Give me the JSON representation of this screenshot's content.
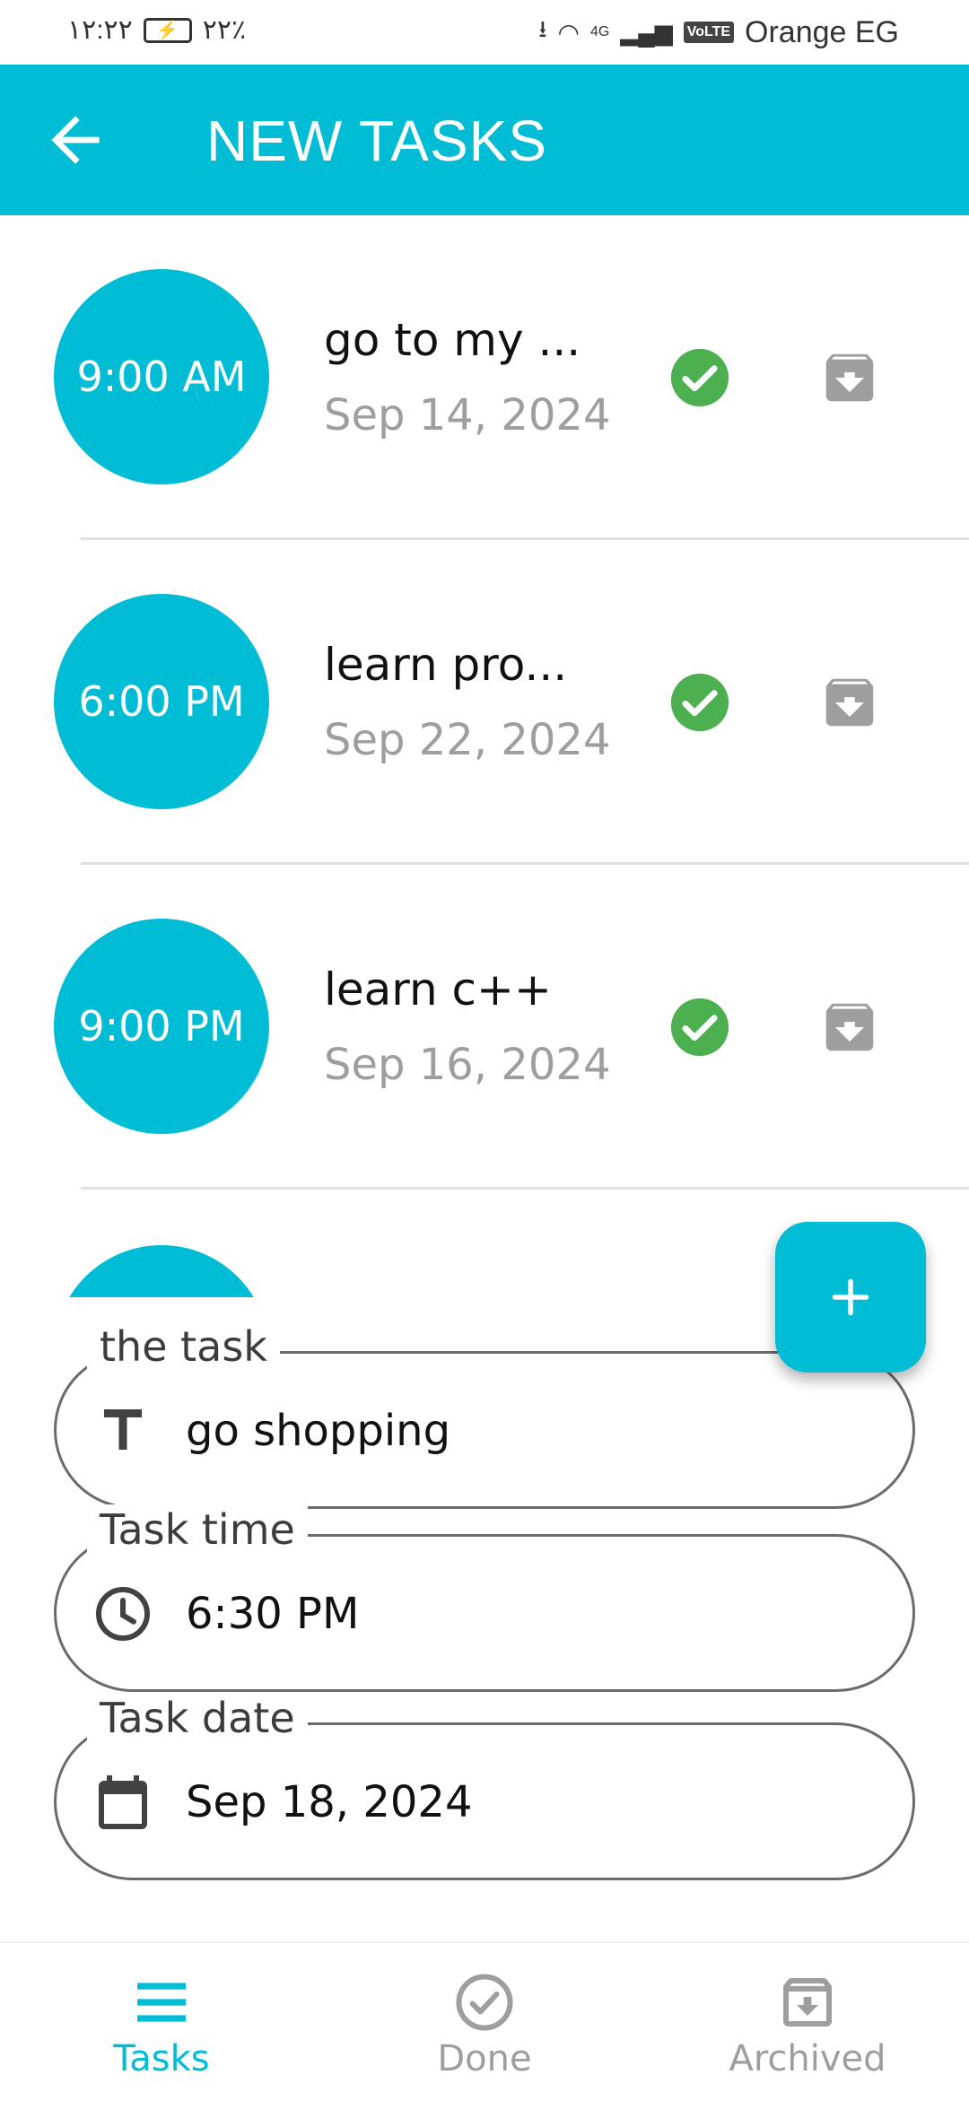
{
  "status_bar": {
    "time": "١٢:٢٢",
    "battery": "٢٢٪",
    "network": "4G",
    "volte": "VoLTE",
    "carrier": "Orange EG"
  },
  "app_bar": {
    "title": "NEW TASKS",
    "back_icon": "arrow-left-icon"
  },
  "tasks": [
    {
      "time": "9:00 AM",
      "title": "go to my ...",
      "date": "Sep 14, 2024"
    },
    {
      "time": "6:00 PM",
      "title": "learn pro...",
      "date": "Sep 22, 2024"
    },
    {
      "time": "9:00 PM",
      "title": "learn c++",
      "date": "Sep 16, 2024"
    }
  ],
  "form": {
    "task": {
      "label": "the task",
      "value": "go shopping",
      "icon": "text-icon"
    },
    "time": {
      "label": "Task time",
      "value": "6:30 PM",
      "icon": "clock-icon"
    },
    "date": {
      "label": "Task date",
      "value": "Sep 18, 2024",
      "icon": "calendar-icon"
    }
  },
  "fab": {
    "icon": "plus-icon"
  },
  "bottom_nav": [
    {
      "label": "Tasks",
      "icon": "menu-icon",
      "active": true
    },
    {
      "label": "Done",
      "icon": "check-circle-icon",
      "active": false
    },
    {
      "label": "Archived",
      "icon": "archive-icon",
      "active": false
    }
  ],
  "colors": {
    "primary": "#00bcd4",
    "done_green": "#4caf50",
    "archive_grey": "#9e9e9e",
    "secondary_text": "#9e9e9e"
  }
}
